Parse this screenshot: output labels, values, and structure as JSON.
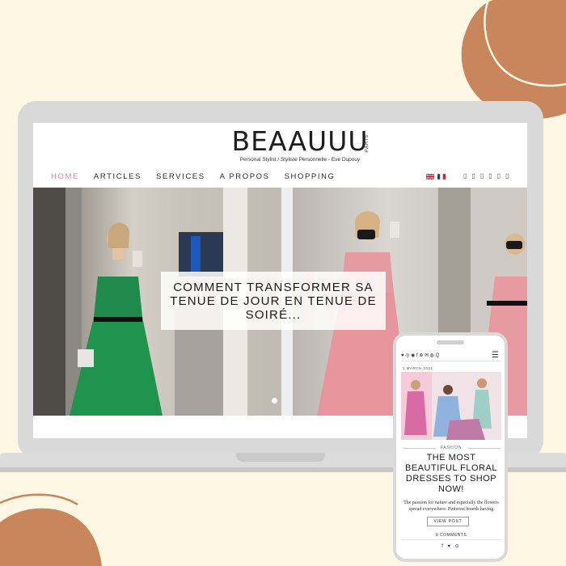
{
  "site": {
    "logo": "BEAAUUU",
    "logo_paris": "PARIS",
    "tagline": "Personal Stylist / Styliste Personnelle - Eve Dupouy"
  },
  "nav": {
    "items": [
      {
        "label": "HOME",
        "active": true
      },
      {
        "label": "ARTICLES",
        "active": false
      },
      {
        "label": "SERVICES",
        "active": false
      },
      {
        "label": "A PROPOS",
        "active": false
      },
      {
        "label": "SHOPPING",
        "active": false
      }
    ],
    "flags": [
      "uk-flag-icon",
      "france-flag-icon"
    ],
    "social_icons": [
      "icon",
      "icon",
      "icon",
      "icon",
      "icon",
      "icon"
    ],
    "social_glyphs": [
      "▯",
      "▯",
      "▯",
      "▯",
      "▯",
      "▯"
    ]
  },
  "hero": {
    "headline": "COMMENT TRANSFORMER SA TENUE DE JOUR EN TENUE DE SOIRÉ..."
  },
  "mobile": {
    "date": "1 MARCH 2021",
    "category": "FASHION",
    "title": "THE MOST BEAUTIFUL FLORAL DRESSES TO SHOP NOW!",
    "excerpt": "The passion for nature and especially the flowers spread everywhere. Pinterest boards having",
    "button": "VIEW POST",
    "comments": "0 COMMENTS",
    "share": "f ♥ ⊙",
    "top_icons": "♥ ◎ ◉ f ⊕ ✉ ◍ Q",
    "menu": "☰"
  },
  "colors": {
    "background": "#fdf7e3",
    "blob": "#c9865c",
    "nav_active": "#e07cb2",
    "laptop": "#d9d9d9"
  }
}
